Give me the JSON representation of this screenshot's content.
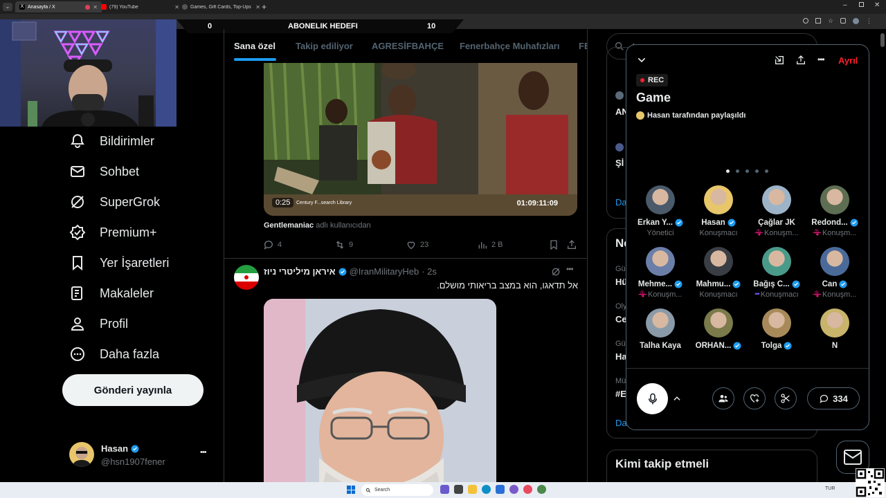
{
  "browser": {
    "tabs": [
      {
        "label": "Anasayfa / X",
        "active": true
      },
      {
        "label": "(79) YouTube",
        "active": false
      },
      {
        "label": "Games, Gift Cards, Top-Ups & M...",
        "active": false
      }
    ]
  },
  "subscription_bar": {
    "left_value": "0",
    "title": "ABONELIK HEDEFI",
    "right_value": "10"
  },
  "nav": {
    "items": [
      {
        "label": "Bildirimler",
        "icon": "bell-icon"
      },
      {
        "label": "Sohbet",
        "icon": "envelope-icon"
      },
      {
        "label": "SuperGrok",
        "icon": "grok-icon"
      },
      {
        "label": "Premium+",
        "icon": "premium-icon"
      },
      {
        "label": "Yer İşaretleri",
        "icon": "bookmark-icon"
      },
      {
        "label": "Makaleler",
        "icon": "article-icon"
      },
      {
        "label": "Profil",
        "icon": "person-icon"
      },
      {
        "label": "Daha fazla",
        "icon": "more-circle-icon"
      }
    ],
    "post_button": "Gönderi yayınla",
    "profile": {
      "name": "Hasan",
      "handle": "@hsn1907fener",
      "more": "•••"
    }
  },
  "timeline": {
    "tabs": [
      "Sana özel",
      "Takip ediliyor",
      "AGRESİFBAHÇE",
      "Fenerbahçe Muhafızları",
      "FE"
    ],
    "post1": {
      "video_time": "0:25",
      "video_duration": "01:09:11:09",
      "video_watermark": "Century F...search Library",
      "from_user": "Gentlemaniac",
      "from_suffix": "adlı kullanıcıdan",
      "replies": "4",
      "reposts": "9",
      "likes": "23",
      "views": "2 B"
    },
    "post2": {
      "name": "איראן מיליטרי ניוז",
      "handle": "@IranMilitaryHeb",
      "time": "· 2s",
      "text": "אל תדאגו, הוא במצב בריאותי מושלם."
    }
  },
  "right": {
    "search_placeholder": "A",
    "snippets": [
      "AN",
      "Şİ",
      "Da",
      "Ne",
      "Gü",
      "Hü",
      "Oly",
      "Ce",
      "Gü",
      "Ha",
      "Mü",
      "#E",
      "Da"
    ],
    "who_to_follow": "Kimi takip etmeli"
  },
  "space": {
    "leave": "Ayrıl",
    "rec": "REC",
    "title": "Game",
    "subtitle": "Hasan tarafından paylaşıldı",
    "page_dots": 5,
    "active_dot": 0,
    "speakers": [
      {
        "name": "Erkan Y...",
        "role": "Yönetici",
        "verified": true,
        "muted": false,
        "color": "#4a5a6a"
      },
      {
        "name": "Hasan",
        "role": "Konuşmacı",
        "verified": true,
        "muted": false,
        "color": "#e8c66a"
      },
      {
        "name": "Çağlar JK",
        "role": "Konuşm...",
        "verified": false,
        "muted": true,
        "color": "#9db4c8"
      },
      {
        "name": "Redond...",
        "role": "Konuşm...",
        "verified": true,
        "muted": true,
        "color": "#5e6e52"
      },
      {
        "name": "Mehme...",
        "role": "Konuşm...",
        "verified": true,
        "muted": true,
        "color": "#6a7ea8"
      },
      {
        "name": "Mahmu...",
        "role": "Konuşmacı",
        "verified": true,
        "muted": false,
        "color": "#3a3e44"
      },
      {
        "name": "Bağış C...",
        "role": "Konuşmacı",
        "verified": true,
        "muted": false,
        "speaking": true,
        "color": "#4a9a8a"
      },
      {
        "name": "Can",
        "role": "Konuşm...",
        "verified": true,
        "muted": true,
        "color": "#4a6a9a"
      },
      {
        "name": "Talha Kaya",
        "role": "",
        "verified": false,
        "muted": false,
        "color": "#8a9aa8"
      },
      {
        "name": "ORHAN...",
        "role": "",
        "verified": true,
        "muted": false,
        "color": "#7a7a4a"
      },
      {
        "name": "Tolga",
        "role": "",
        "verified": true,
        "muted": false,
        "color": "#a88a5a"
      },
      {
        "name": "N",
        "role": "",
        "verified": false,
        "muted": false,
        "color": "#c8b46a"
      }
    ],
    "comment_count": "334"
  },
  "taskbar": {
    "search": "Search",
    "lang": "TUR"
  },
  "colors": {
    "accent": "#1d9bf0",
    "danger": "#f4212e",
    "muted_icon": "#f91880"
  }
}
